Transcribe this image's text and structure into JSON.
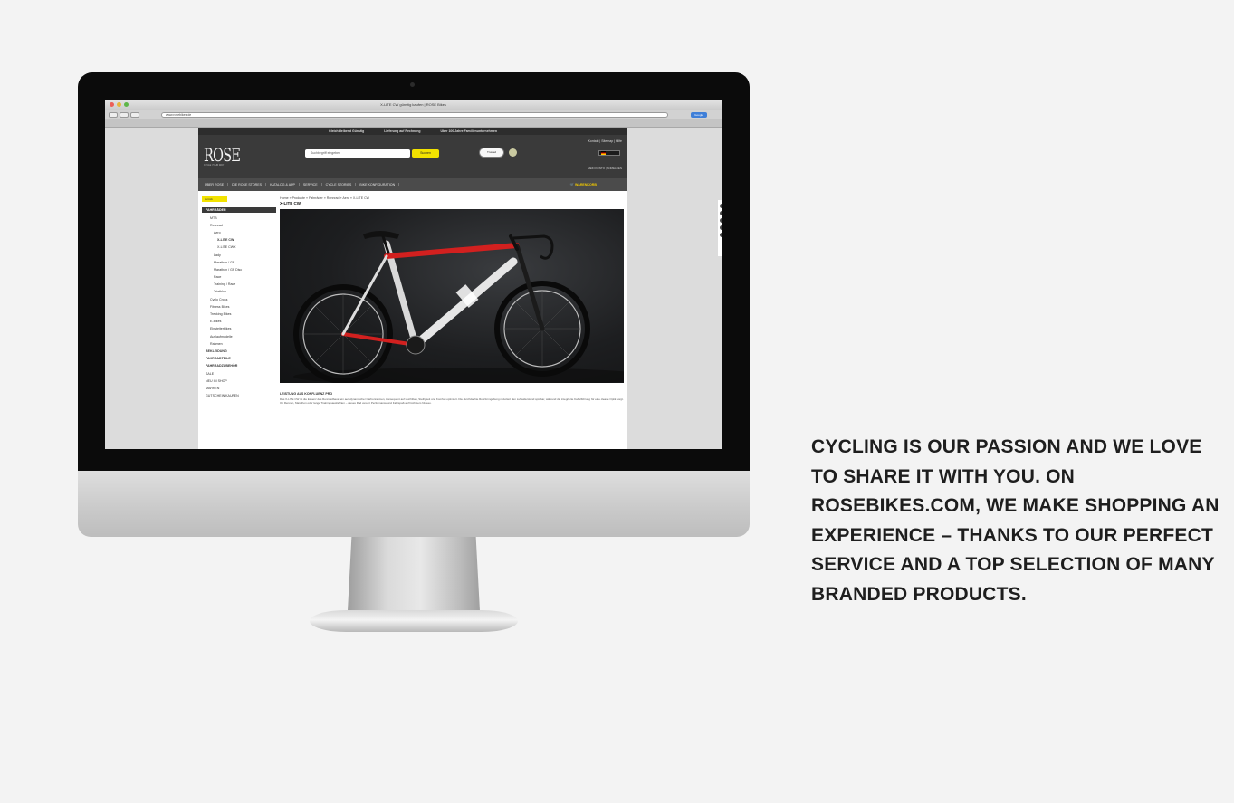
{
  "browser": {
    "window_title": "X-LITE CW günstig kaufen | ROSE Bikes",
    "url": "www.rosebikes.de",
    "go_label": "Google"
  },
  "site": {
    "top_strip": [
      "Gleichbleibend Günstig",
      "Lieferung auf Rechnung",
      "Über 100 Jahre Familienunternehmen"
    ],
    "logo": "ROSE",
    "logo_sub": "CYCLE YOUR WAY",
    "search_placeholder": "Suchbegriff eingeben",
    "search_button": "Suchen",
    "badge": "Trusted",
    "top_links": "Kontakt | Sitemap | Hilfe",
    "account": "MEIN KONTO | ANMELDEN",
    "main_nav": [
      "ÜBER ROSE",
      "DIE ROSE STORES",
      "KATALOG & APP",
      "SERVICE",
      "CYCLE STORIES",
      "BIKE KONFIGURATION"
    ],
    "cart_label": "WARENKORB",
    "sidebar": {
      "back": "zurück",
      "active": "FAHRRÄDER",
      "items": [
        {
          "label": "MTB",
          "level": 2,
          "bold": false
        },
        {
          "label": "Rennrad",
          "level": 2,
          "bold": false
        },
        {
          "label": "Aero",
          "level": 3,
          "bold": false
        },
        {
          "label": "X-LITE CW",
          "level": 4,
          "bold": true
        },
        {
          "label": "X-LITE CWX",
          "level": 4,
          "bold": false
        },
        {
          "label": "Lady",
          "level": 3,
          "bold": false
        },
        {
          "label": "Marathon / GF",
          "level": 3,
          "bold": false
        },
        {
          "label": "Marathon / GF Disc",
          "level": 3,
          "bold": false
        },
        {
          "label": "Race",
          "level": 3,
          "bold": false
        },
        {
          "label": "Training / Race",
          "level": 3,
          "bold": false
        },
        {
          "label": "Triathlon",
          "level": 3,
          "bold": false
        },
        {
          "label": "Cyclo Cross",
          "level": 2,
          "bold": false
        },
        {
          "label": "Fitness Bikes",
          "level": 2,
          "bold": false
        },
        {
          "label": "Trekking Bikes",
          "level": 2,
          "bold": false
        },
        {
          "label": "E-Bikes",
          "level": 2,
          "bold": false
        },
        {
          "label": "Einsteiterbikes",
          "level": 2,
          "bold": false
        },
        {
          "label": "Auslaufmodelle",
          "level": 2,
          "bold": false
        },
        {
          "label": "Rahmen",
          "level": 2,
          "bold": false
        },
        {
          "label": "BEKLEIDUNG",
          "level": 1,
          "bold": true
        },
        {
          "label": "FAHRRADTEILE",
          "level": 1,
          "bold": true
        },
        {
          "label": "FAHRRADZUBEHÖR",
          "level": 1,
          "bold": true
        },
        {
          "label": "SALE",
          "level": 1,
          "bold": false
        },
        {
          "label": "NEU IM SHOP",
          "level": 1,
          "bold": false
        },
        {
          "label": "MARKEN",
          "level": 1,
          "bold": false
        },
        {
          "label": "GUTSCHEIN KAUFEN",
          "level": 1,
          "bold": false
        }
      ]
    },
    "breadcrumb": "Home » Produkte » Fahrräder » Rennrad » Aero » X-LITE CW",
    "product_title": "X-LITE CW",
    "description_heading": "LEISTUNG ALS KONFLUENZ PRO",
    "description": "Das X-LITE CW ist die Essenz des Rennradbaus: ein aerodynamischer Carbonrahmen, konsequent auf Leichtbau, Steifigkeit und Komfort optimiert. Die durchdachte Rohrformgebung reduziert den Luftwiderstand spürbar, während die integrierte Kabelführung für eine cleane Optik sorgt. Ob Rennen, Marathon oder lange Trainingsausfahrten – dieses Rad vereint Performance und Fahrspaß auf höchstem Niveau."
  },
  "tagline": "CYCLING IS OUR PASSION AND WE LOVE TO SHARE IT WITH YOU. ON ROSEBIKES.COM, WE MAKE SHOPPING AN EXPERIENCE – THANKS TO OUR PERFECT SERVICE AND A TOP SELECTION OF MANY BRANDED PRODUCTS.",
  "colors": {
    "page_background": "#f3f3f3",
    "accent_yellow": "#f2e200",
    "site_header": "#3a3a3a",
    "bike_red": "#d2201f"
  }
}
